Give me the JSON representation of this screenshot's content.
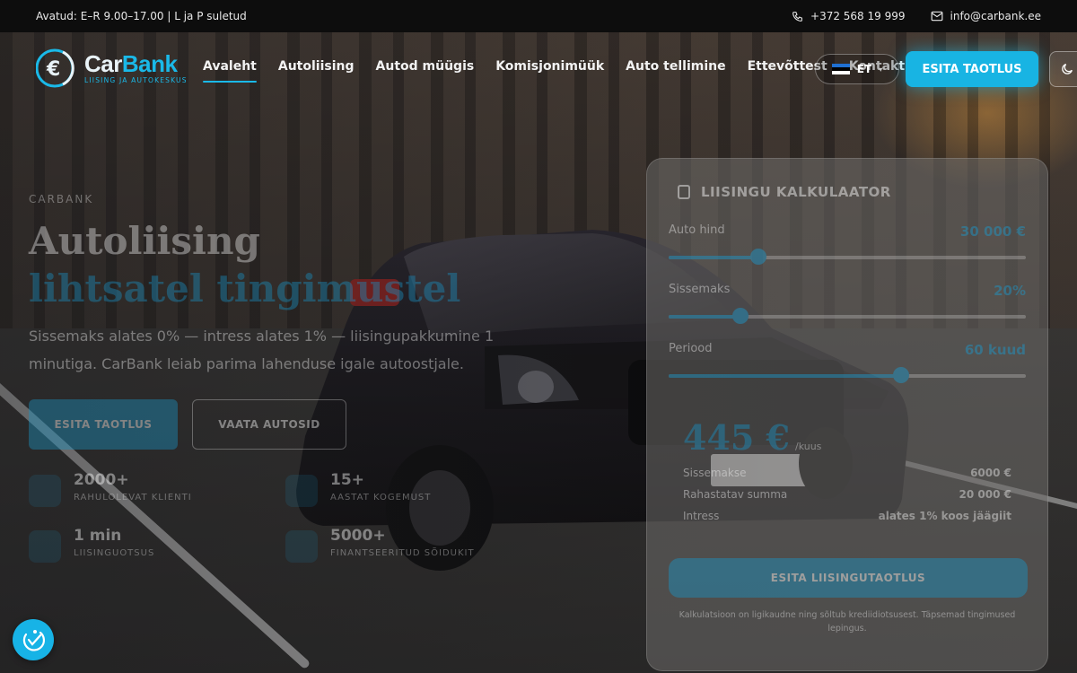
{
  "topbar": {
    "hours": "Avatud: E–R 9.00–17.00 | L ja P suletud",
    "phone": "+372 568 19 999",
    "email": "info@carbank.ee"
  },
  "logo": {
    "name_a": "Car",
    "name_b": "Bank",
    "tagline": "LIISING JA AUTOKESKUS"
  },
  "nav": {
    "items": [
      {
        "label": "Avaleht",
        "active": true
      },
      {
        "label": "Autoliising"
      },
      {
        "label": "Autod müügis"
      },
      {
        "label": "Komisjonimüük"
      },
      {
        "label": "Auto tellimine"
      },
      {
        "label": "Ettevõttest"
      },
      {
        "label": "Kontakt"
      }
    ],
    "language": "ET",
    "apply_label": "ESITA TAOTLUS"
  },
  "hero": {
    "eyebrow": "CARBANK",
    "title_line1": "Autoliising",
    "title_line2": "lihtsatel tingimustel",
    "lead": "Sissemaks alates 0% — intress alates 1% — liisingupakkumine 1 minutiga. CarBank leiab parima lahenduse igale autoostjale.",
    "primary_btn": "ESITA TAOTLUS",
    "secondary_btn": "VAATA AUTOSID",
    "stats": [
      {
        "value": "2000+",
        "label": "RAHULOLEVAT KLIENTI"
      },
      {
        "value": "15+",
        "label": "AASTAT KOGEMUST"
      },
      {
        "value": "1 min",
        "label": "LIISINGUOTSUS"
      },
      {
        "value": "5000+",
        "label": "FINANTSEERITUD SÕIDUKIT"
      }
    ]
  },
  "calculator": {
    "title": "LIISINGU KALKULAATOR",
    "rows": [
      {
        "label": "Auto hind",
        "value": "30 000 €",
        "level": 0.25
      },
      {
        "label": "Sissemaks",
        "value": "20%",
        "level": 0.2
      },
      {
        "label": "Periood",
        "value": "60 kuud",
        "level": 0.65
      }
    ],
    "monthly": "445 €",
    "monthly_unit": "/kuus",
    "summary": [
      {
        "label": "Sissemakse",
        "value": "6000 €"
      },
      {
        "label": "Rahastatav summa",
        "value": "20 000 €"
      },
      {
        "label": "Intress",
        "value": "alates 1% koos jäägiit"
      }
    ],
    "submit": "ESITA LIISINGUTAOTLUS",
    "note": "Kalkulatsioon on ligikaudne ning sõltub krediidiotsusest. Täpsemad tingimused lepingus."
  },
  "colors": {
    "accent": "#18b4e3",
    "topbar": "#0d0d0d"
  }
}
